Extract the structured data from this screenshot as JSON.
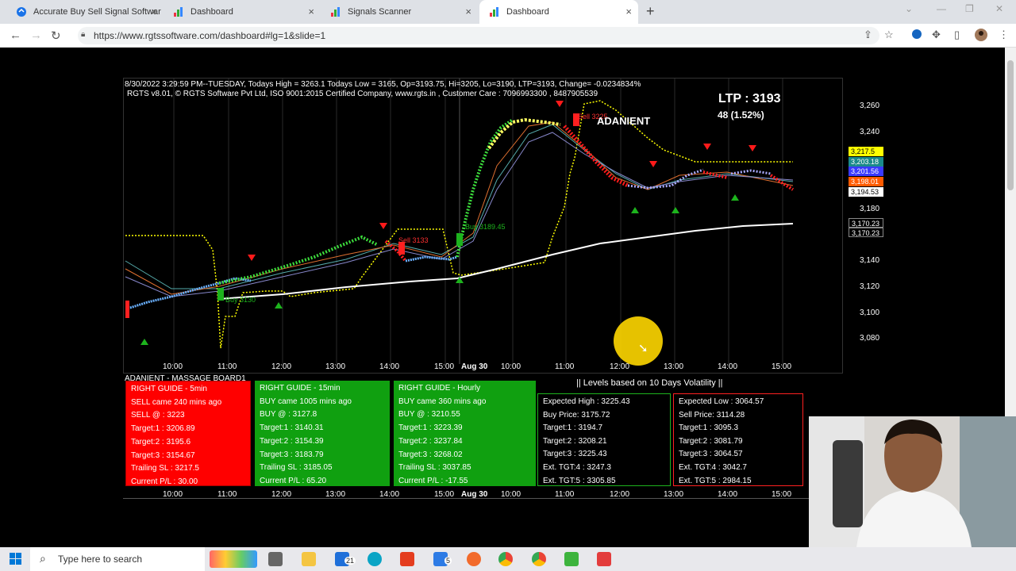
{
  "browser": {
    "tabs": [
      {
        "label": "Accurate Buy Sell Signal Softwar",
        "active": false
      },
      {
        "label": "Dashboard",
        "active": false
      },
      {
        "label": "Signals Scanner",
        "active": false
      },
      {
        "label": "Dashboard",
        "active": true
      }
    ],
    "url": "https://www.rgtssoftware.com/dashboard#lg=1&slide=1"
  },
  "chart": {
    "header_line1": "8/30/2022 3:29:59 PM--TUESDAY, Todays High = 3263.1 Todays Low = 3165, Op=3193.75, Hi=3205, Lo=3190, LTP=3193, Change= -0.0234834%",
    "header_line2": "RGTS v8.01, © RGTS Software Pvt Ltd, ISO 9001:2015 Certified Company, www.rgts.in , Customer Care : 7096993300 , 8487905539",
    "ltp": "LTP : 3193",
    "change": "48 (1.52%)",
    "symbol": "ADANIENT",
    "signal_sell_1": "Sell 3225",
    "signal_sell_2": "Sell 3133",
    "signal_buy_1": "Buy 3189.45",
    "signal_buy_2": "Buy 3130",
    "y_ticks": [
      "3,260",
      "3,240",
      "3,180",
      "3,140",
      "3,120",
      "3,100",
      "3,080"
    ],
    "y_boxes": [
      {
        "label": "3,217.5",
        "bg": "#ffff00",
        "color": "#000"
      },
      {
        "label": "3,203.18",
        "bg": "#1a8a8a",
        "color": "#fff"
      },
      {
        "label": "3,201.56",
        "bg": "#3a3aff",
        "color": "#fff"
      },
      {
        "label": "3,198.01",
        "bg": "#ff5a00",
        "color": "#fff"
      },
      {
        "label": "3,194.53",
        "bg": "#ffffff",
        "color": "#000"
      },
      {
        "label": "3,170.23",
        "bg": "#000",
        "color": "#fff"
      },
      {
        "label": "3,170.23",
        "bg": "#000",
        "color": "#fff"
      }
    ],
    "x_ticks": [
      "10:00",
      "11:00",
      "12:00",
      "13:00",
      "14:00",
      "15:00",
      "Aug 30",
      "10:00",
      "11:00",
      "12:00",
      "13:00",
      "14:00",
      "15:00"
    ],
    "massage_board": "ADANIENT - MASSAGE BOARD1",
    "volatility_title": "|| Levels based on 10 Days Volatility ||"
  },
  "panels": [
    {
      "title": "RIGHT GUIDE - 5min",
      "rows": [
        "SELL came 240 mins ago",
        "SELL @ : 3223",
        "Target:1 : 3206.89",
        "Target:2 : 3195.6",
        "Target:3 : 3154.67",
        "Trailing SL : 3217.5",
        "Current P/L : 30.00"
      ]
    },
    {
      "title": "RIGHT GUIDE - 15min",
      "rows": [
        "BUY came 1005 mins ago",
        "BUY @ : 3127.8",
        "Target:1 : 3140.31",
        "Target:2 : 3154.39",
        "Target:3 : 3183.79",
        "Trailing SL : 3185.05",
        "Current P/L : 65.20"
      ]
    },
    {
      "title": "RIGHT GUIDE - Hourly",
      "rows": [
        "BUY came 360 mins ago",
        "BUY @ : 3210.55",
        "Target:1 : 3223.39",
        "Target:2 : 3237.84",
        "Target:3 : 3268.02",
        "Trailing SL : 3037.85",
        "Current P/L : -17.55"
      ]
    },
    {
      "title": "",
      "rows": [
        "Expected High : 3225.43",
        "Buy Price: 3175.72",
        "Target:1 : 3194.7",
        "Target:2 : 3208.21",
        "Target:3 : 3225.43",
        "Ext. TGT:4 : 3247.3",
        "Ext. TGT:5 : 3305.85"
      ]
    },
    {
      "title": "",
      "rows": [
        "Expected Low : 3064.57",
        "Sell Price: 3114.28",
        "Target:1 : 3095.3",
        "Target:2 : 3081.79",
        "Target:3 : 3064.57",
        "Ext. TGT:4 : 3042.7",
        "Ext. TGT:5 : 2984.15"
      ]
    }
  ],
  "taskbar": {
    "search_placeholder": "Type here to search",
    "badge_1": "21",
    "badge_2": "5"
  }
}
